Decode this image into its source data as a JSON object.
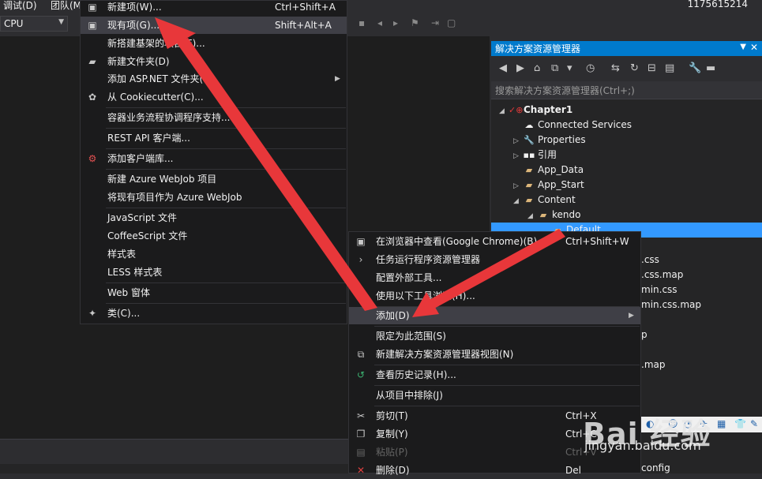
{
  "menubar": {
    "debug": "调试(D)",
    "team": "团队(M",
    "user": "1175615214"
  },
  "toolbar": {
    "platform": "CPU"
  },
  "solution_explorer": {
    "title": "解决方案资源管理器",
    "search_placeholder": "搜索解决方案资源管理器(Ctrl+;)",
    "tree": [
      {
        "label": "Chapter1"
      },
      {
        "label": "Connected Services"
      },
      {
        "label": "Properties"
      },
      {
        "label": "引用"
      },
      {
        "label": "App_Data"
      },
      {
        "label": "App_Start"
      },
      {
        "label": "Content"
      },
      {
        "label": "kendo"
      },
      {
        "label": "Default"
      }
    ],
    "partial_items": [
      ".css",
      ".css.map",
      "min.css",
      "min.css.map",
      "p",
      ".map",
      "config"
    ]
  },
  "left_menu": {
    "items": [
      {
        "label": "新建项(W)...",
        "shortcut": "Ctrl+Shift+A"
      },
      {
        "label": "现有项(G)...",
        "shortcut": "Shift+Alt+A"
      },
      {
        "label": "新搭建基架的项目(F)..."
      },
      {
        "label": "新建文件夹(D)"
      },
      {
        "label": "添加 ASP.NET 文件夹(S)"
      },
      {
        "label": "从 Cookiecutter(C)..."
      },
      {
        "label": "容器业务流程协调程序支持..."
      },
      {
        "label": "REST API 客户端..."
      },
      {
        "label": "添加客户端库..."
      },
      {
        "label": "新建 Azure WebJob 项目"
      },
      {
        "label": "将现有项目作为 Azure WebJob"
      },
      {
        "label": "JavaScript 文件"
      },
      {
        "label": "CoffeeScript 文件"
      },
      {
        "label": "样式表"
      },
      {
        "label": "LESS 样式表"
      },
      {
        "label": "Web 窗体"
      },
      {
        "label": "类(C)..."
      }
    ]
  },
  "right_menu": {
    "items": [
      {
        "label": "在浏览器中查看(Google Chrome)(B)",
        "shortcut": "Ctrl+Shift+W"
      },
      {
        "label": "任务运行程序资源管理器"
      },
      {
        "label": "配置外部工具..."
      },
      {
        "label": "使用以下工具浏览(H)..."
      },
      {
        "label": "添加(D)"
      },
      {
        "label": "限定为此范围(S)"
      },
      {
        "label": "新建解决方案资源管理器视图(N)"
      },
      {
        "label": "查看历史记录(H)..."
      },
      {
        "label": "从项目中排除(J)"
      },
      {
        "label": "剪切(T)",
        "shortcut": "Ctrl+X"
      },
      {
        "label": "复制(Y)",
        "shortcut": "Ctrl+C"
      },
      {
        "label": "粘贴(P)",
        "shortcut": "Ctrl+V"
      },
      {
        "label": "删除(D)",
        "shortcut": "Del"
      }
    ]
  },
  "watermark": {
    "brand": "Bai 经验",
    "url": "jingyan.baidu.com"
  },
  "colors": {
    "accent": "#007acc",
    "selection": "#3399ff",
    "arrow": "#e8373a",
    "menu_bg": "#1b1b1c"
  }
}
